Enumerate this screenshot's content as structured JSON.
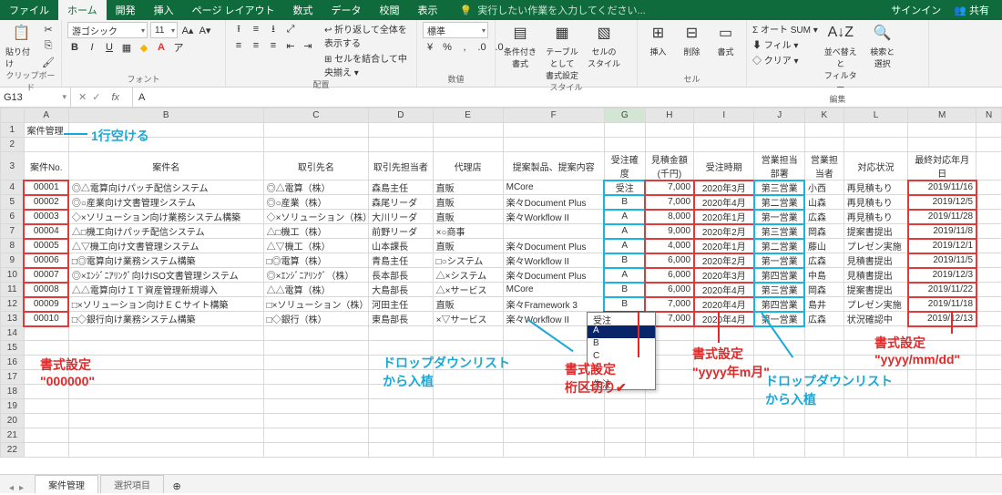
{
  "title": {
    "signin": "サインイン",
    "share": "共有"
  },
  "tabs": [
    "ファイル",
    "ホーム",
    "開発",
    "挿入",
    "ページ レイアウト",
    "数式",
    "データ",
    "校閲",
    "表示"
  ],
  "tellme": "実行したい作業を入力してください...",
  "ribbon": {
    "clipboard": {
      "paste": "貼り付け",
      "title": "クリップボード"
    },
    "font": {
      "name": "游ゴシック",
      "size": "11",
      "title": "フォント"
    },
    "align": {
      "wrap": "折り返して全体を表示する",
      "merge": "セルを結合して中央揃え",
      "title": "配置"
    },
    "number": {
      "fmt": "標準",
      "title": "数値"
    },
    "style": {
      "cond": "条件付き\n書式",
      "table": "テーブルとして\n書式設定",
      "cell": "セルの\nスタイル",
      "title": "スタイル"
    },
    "cells": {
      "insert": "挿入",
      "delete": "削除",
      "format": "書式",
      "title": "セル"
    },
    "edit": {
      "sum": "オート SUM",
      "fill": "フィル",
      "clear": "クリア",
      "sort": "並べ替えと\nフィルター",
      "find": "検索と\n選択",
      "title": "編集"
    }
  },
  "namebox": "G13",
  "formula": "A",
  "cols": [
    "",
    "A",
    "B",
    "C",
    "D",
    "E",
    "F",
    "G",
    "H",
    "I",
    "J",
    "K",
    "L",
    "M",
    "N"
  ],
  "widths": [
    24,
    46,
    200,
    108,
    66,
    72,
    104,
    42,
    50,
    62,
    52,
    40,
    66,
    70,
    26
  ],
  "sheet_title": "案件管理",
  "hdr": {
    "A": "案件No.",
    "B": "案件名",
    "C": "取引先名",
    "D": "取引先担当者",
    "E": "代理店",
    "F": "提案製品、提案内容",
    "G": "受注確度",
    "H": "見積金額\n(千円)",
    "I": "受注時期",
    "J": "営業担当部署",
    "K": "営業担当者",
    "L": "対応状況",
    "M": "最終対応年月日"
  },
  "rows": [
    {
      "no": "00001",
      "name": "◎△電算向けパッチ配信システム",
      "cust": "◎△電算（株）",
      "pic": "森島主任",
      "agent": "直販",
      "prod": "MCore",
      "prob": "受注",
      "amt": "7,000",
      "when": "2020年3月",
      "dept": "第三営業",
      "rep": "小西",
      "stat": "再見積もり",
      "date": "2019/11/16"
    },
    {
      "no": "00002",
      "name": "◎○産業向け文書管理システム",
      "cust": "◎○産業（株）",
      "pic": "森尾リーダ",
      "agent": "直販",
      "prod": "楽々Document Plus",
      "prob": "B",
      "amt": "7,000",
      "when": "2020年4月",
      "dept": "第二営業",
      "rep": "山森",
      "stat": "再見積もり",
      "date": "2019/12/5"
    },
    {
      "no": "00003",
      "name": "◇×ソリューション向け業務システム構築",
      "cust": "◇×ソリューション（株）",
      "pic": "大川リーダ",
      "agent": "直販",
      "prod": "楽々Workflow II",
      "prob": "A",
      "amt": "8,000",
      "when": "2020年1月",
      "dept": "第一営業",
      "rep": "広森",
      "stat": "再見積もり",
      "date": "2019/11/28"
    },
    {
      "no": "00004",
      "name": "△□機工向けパッチ配信システム",
      "cust": "△□機工（株）",
      "pic": "前野リーダ",
      "agent": "×○商事",
      "prod": "",
      "prob": "A",
      "amt": "9,000",
      "when": "2020年2月",
      "dept": "第三営業",
      "rep": "岡森",
      "stat": "提案書提出",
      "date": "2019/11/8"
    },
    {
      "no": "00005",
      "name": "△▽機工向け文書管理システム",
      "cust": "△▽機工（株）",
      "pic": "山本課長",
      "agent": "直販",
      "prod": "楽々Document Plus",
      "prob": "A",
      "amt": "4,000",
      "when": "2020年1月",
      "dept": "第二営業",
      "rep": "藤山",
      "stat": "プレゼン実施",
      "date": "2019/12/1"
    },
    {
      "no": "00006",
      "name": "□◎電算向け業務システム構築",
      "cust": "□◎電算（株）",
      "pic": "青島主任",
      "agent": "□○システム",
      "prod": "楽々Workflow II",
      "prob": "B",
      "amt": "6,000",
      "when": "2020年2月",
      "dept": "第一営業",
      "rep": "広森",
      "stat": "見積書提出",
      "date": "2019/11/5"
    },
    {
      "no": "00007",
      "name": "◎×ｴﾝｼﾞﾆｱﾘﾝｸﾞ向けISO文書管理システム",
      "cust": "◎×ｴﾝｼﾞﾆｱﾘﾝｸﾞ（株）",
      "pic": "長本部長",
      "agent": "△×システム",
      "prod": "楽々Document Plus",
      "prob": "A",
      "amt": "6,000",
      "when": "2020年3月",
      "dept": "第四営業",
      "rep": "中島",
      "stat": "見積書提出",
      "date": "2019/12/3"
    },
    {
      "no": "00008",
      "name": "△△電算向けＩＴ資産管理新規導入",
      "cust": "△△電算（株）",
      "pic": "大島部長",
      "agent": "△×サービス",
      "prod": "MCore",
      "prob": "B",
      "amt": "6,000",
      "when": "2020年4月",
      "dept": "第三営業",
      "rep": "岡森",
      "stat": "提案書提出",
      "date": "2019/11/22"
    },
    {
      "no": "00009",
      "name": "□×ソリューション向けＥＣサイト構築",
      "cust": "□×ソリューション（株）",
      "pic": "河田主任",
      "agent": "直販",
      "prod": "楽々Framework 3",
      "prob": "B",
      "amt": "7,000",
      "when": "2020年4月",
      "dept": "第四営業",
      "rep": "島井",
      "stat": "プレゼン実施",
      "date": "2019/11/18"
    },
    {
      "no": "00010",
      "name": "□◇銀行向け業務システム構築",
      "cust": "□◇銀行（株）",
      "pic": "東島部長",
      "agent": "×▽サービス",
      "prod": "楽々Workflow II",
      "prob": "A",
      "amt": "7,000",
      "when": "2020年4月",
      "dept": "第一営業",
      "rep": "広森",
      "stat": "状況確認中",
      "date": "2019/12/13"
    }
  ],
  "dropdown_items": [
    "受注",
    "A",
    "B",
    "C",
    "D",
    "失注"
  ],
  "sheet_tabs": [
    "案件管理",
    "選択項目"
  ],
  "annos": {
    "blank_row": "1行空ける",
    "fmt_000000_1": "書式設定",
    "fmt_000000_2": "\"000000\"",
    "dd1_1": "ドロップダウンリスト",
    "dd1_2": "から入植",
    "comma_1": "書式設定",
    "comma_2": "桁区切り✔",
    "ym_1": "書式設定",
    "ym_2": "\"yyyy年m月\"",
    "dd2_1": "ドロップダウンリスト",
    "dd2_2": "から入植",
    "ymd_1": "書式設定",
    "ymd_2": "\"yyyy/mm/dd\""
  }
}
